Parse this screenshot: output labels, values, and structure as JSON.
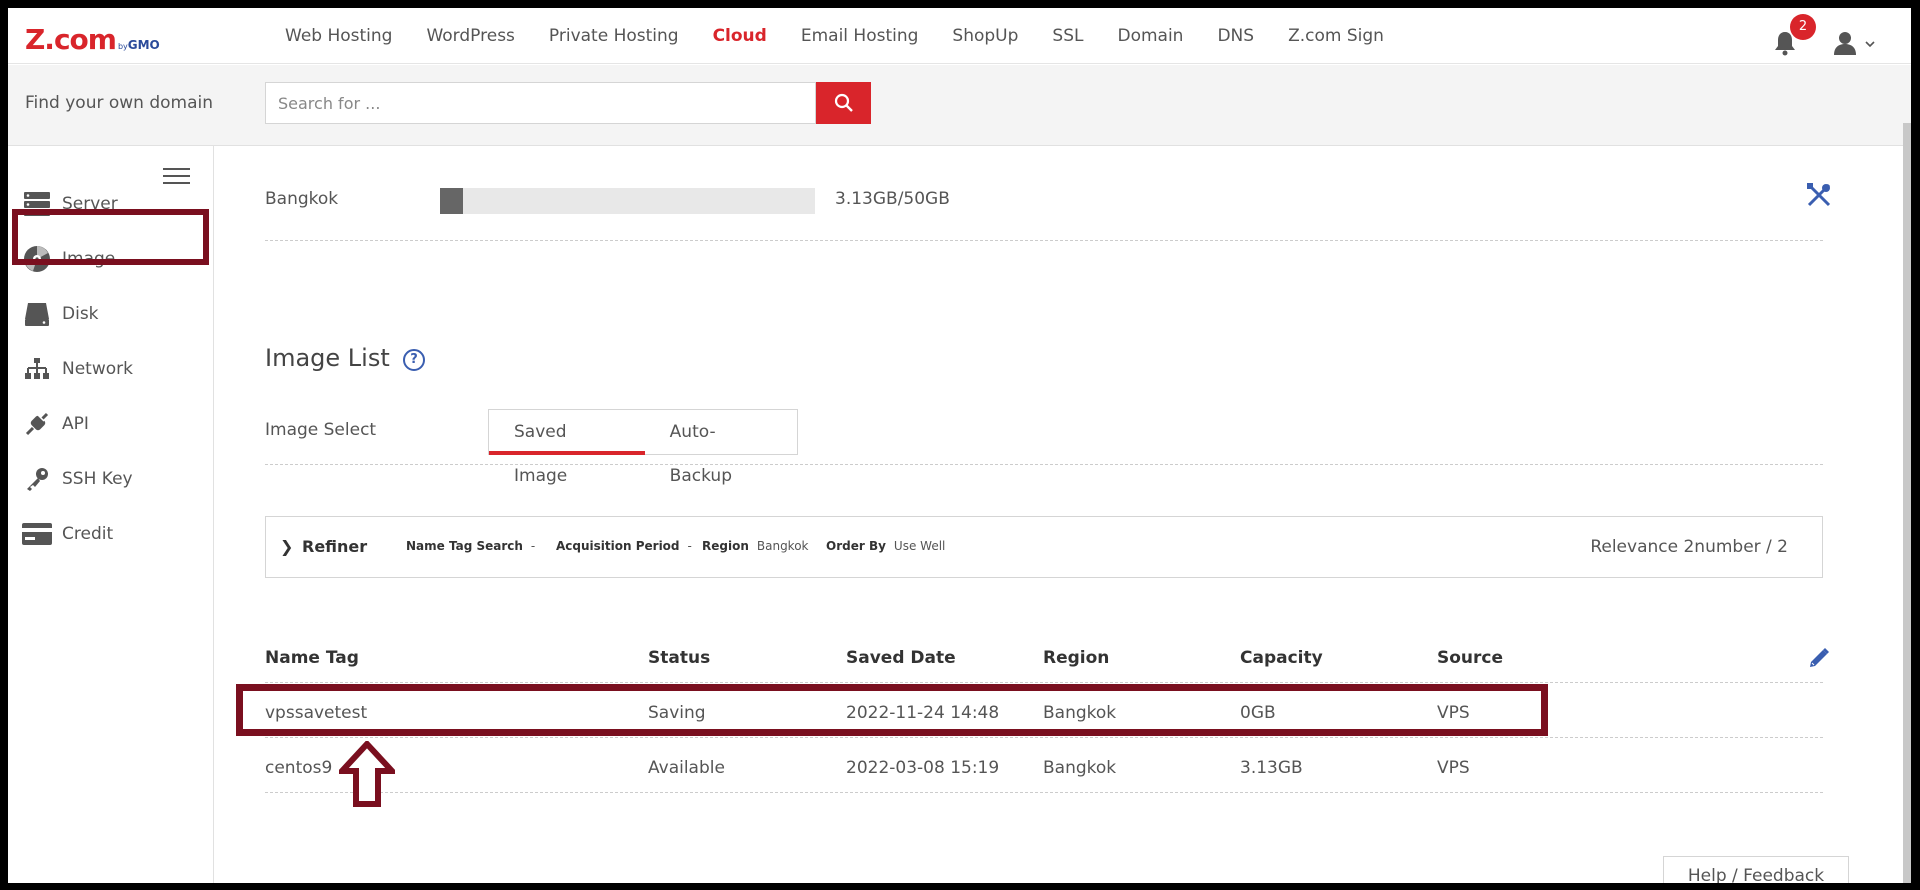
{
  "app": {
    "logo_main": "Z.com",
    "logo_by": "by",
    "logo_gmo": "GMO"
  },
  "nav": {
    "items": [
      {
        "label": "Web Hosting"
      },
      {
        "label": "WordPress"
      },
      {
        "label": "Private Hosting"
      },
      {
        "label": "Cloud",
        "active": true
      },
      {
        "label": "Email Hosting"
      },
      {
        "label": "ShopUp"
      },
      {
        "label": "SSL"
      },
      {
        "label": "Domain"
      },
      {
        "label": "DNS"
      },
      {
        "label": "Z.com Sign"
      }
    ],
    "notification_count": "2",
    "bell_icon": "bell-icon",
    "user_icon": "user-icon"
  },
  "search": {
    "label": "Find your own domain",
    "placeholder": "Search for ...",
    "button_icon": "search-icon"
  },
  "sidebar": {
    "items": [
      {
        "label": "Server",
        "icon": "server-icon"
      },
      {
        "label": "Image",
        "icon": "disc-icon",
        "active": true
      },
      {
        "label": "Disk",
        "icon": "disk-icon"
      },
      {
        "label": "Network",
        "icon": "network-icon"
      },
      {
        "label": "API",
        "icon": "api-icon"
      },
      {
        "label": "SSH Key",
        "icon": "key-icon"
      },
      {
        "label": "Credit",
        "icon": "credit-card-icon"
      }
    ]
  },
  "storage": {
    "region": "Bangkok",
    "usage_text": "3.13GB/50GB",
    "used_fraction": 0.06
  },
  "image_list": {
    "title": "Image List",
    "help_glyph": "?",
    "select_label": "Image Select",
    "tabs": [
      {
        "label": "Saved Image",
        "active": true
      },
      {
        "label": "Auto-Backup"
      }
    ]
  },
  "refiner": {
    "chevron": "❯",
    "label": "Refiner",
    "filters": [
      {
        "key": "Name Tag Search",
        "value": "-"
      },
      {
        "key": "Acquisition Period",
        "value": "-"
      },
      {
        "key": "Region",
        "value": "Bangkok"
      },
      {
        "key": "Order By",
        "value": "Use Well"
      }
    ],
    "relevance": "Relevance 2number / 2"
  },
  "table": {
    "headers": [
      "Name Tag",
      "Status",
      "Saved Date",
      "Region",
      "Capacity",
      "Source"
    ],
    "rows": [
      [
        "vpssavetest",
        "Saving",
        "2022-11-24 14:48",
        "Bangkok",
        "0GB",
        "VPS"
      ],
      [
        "centos9",
        "Available",
        "2022-03-08 15:19",
        "Bangkok",
        "3.13GB",
        "VPS"
      ]
    ]
  },
  "footer": {
    "help_feedback": "Help / Feedback"
  },
  "colors": {
    "brand_red": "#d9252b",
    "annotation": "#7a0f1f",
    "link_blue": "#3a5eb0"
  }
}
